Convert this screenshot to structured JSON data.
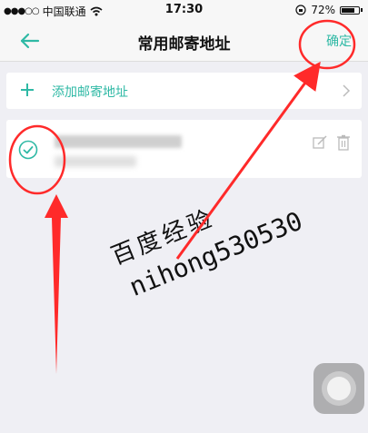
{
  "status_bar": {
    "carrier": "中国联通",
    "time": "17:30",
    "battery": "72%",
    "signal_icon": "signal-dots",
    "wifi_icon": "wifi-icon",
    "lock_icon": "rotation-lock-icon"
  },
  "nav": {
    "title": "常用邮寄地址",
    "confirm_label": "确定",
    "back_icon": "back-arrow-icon"
  },
  "add_address": {
    "label": "添加邮寄地址",
    "icon": "plus-icon",
    "chevron": "chevron-right-icon"
  },
  "address_card": {
    "selected": true,
    "check_icon": "check-circle-icon",
    "edit_icon": "edit-icon",
    "delete_icon": "trash-icon"
  },
  "watermark": {
    "line1": "百度经验",
    "line2": "nihong530530"
  },
  "colors": {
    "accent": "#2fb9a5",
    "annotation": "#ff2a2a",
    "background": "#efeff4"
  }
}
